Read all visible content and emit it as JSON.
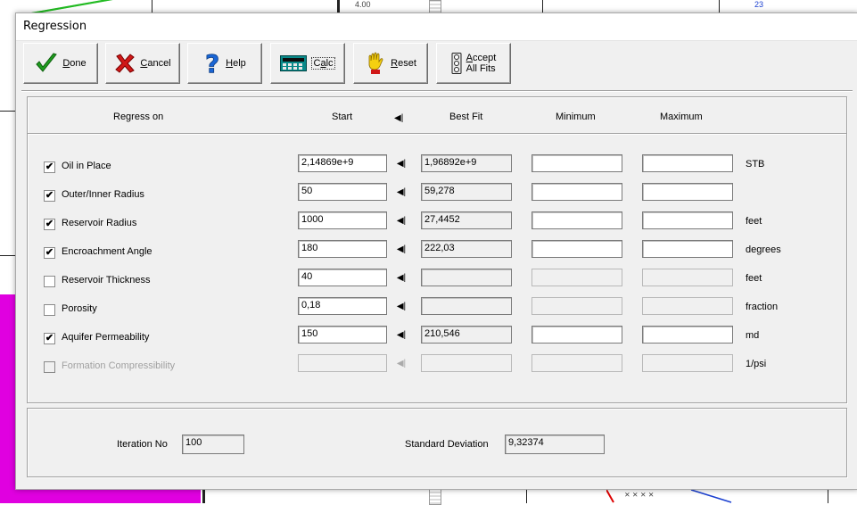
{
  "background": {
    "tick_label": "4.00",
    "tick_label_2": "23"
  },
  "dialog": {
    "title": "Regression"
  },
  "toolbar": {
    "done": {
      "prefix": "",
      "mnemonic": "D",
      "suffix": "one",
      "icon": "checkmark-icon"
    },
    "cancel": {
      "prefix": "",
      "mnemonic": "C",
      "suffix": "ancel",
      "icon": "red-x-icon"
    },
    "help": {
      "prefix": "",
      "mnemonic": "H",
      "suffix": "elp",
      "icon": "question-mark-icon"
    },
    "calc": {
      "prefix": "C",
      "mnemonic": "a",
      "suffix": "lc",
      "icon": "calculator-icon"
    },
    "reset": {
      "prefix": "",
      "mnemonic": "R",
      "suffix": "eset",
      "icon": "hand-stop-icon"
    },
    "accept": {
      "line1_prefix": "",
      "line1_mnemonic": "A",
      "line1_suffix": "ccept",
      "line2": "All Fits",
      "icon": "traffic-light-icon"
    }
  },
  "table": {
    "headers": {
      "regress_on": "Regress on",
      "start": "Start",
      "best_fit": "Best Fit",
      "minimum": "Minimum",
      "maximum": "Maximum"
    },
    "arrow_glyph": "◀|",
    "rows": [
      {
        "label": "Oil in Place",
        "checked": true,
        "enabled": true,
        "check_glyph": "✔",
        "start": "2,14869e+9",
        "best_fit": "1,96892e+9",
        "minimum": "",
        "maximum": "",
        "unit": "STB"
      },
      {
        "label": "Outer/Inner Radius",
        "checked": true,
        "enabled": true,
        "check_glyph": "✔",
        "start": "50",
        "best_fit": "59,278",
        "minimum": "",
        "maximum": "",
        "unit": ""
      },
      {
        "label": "Reservoir Radius",
        "checked": true,
        "enabled": true,
        "check_glyph": "✔",
        "start": "1000",
        "best_fit": "27,4452",
        "minimum": "",
        "maximum": "",
        "unit": "feet"
      },
      {
        "label": "Encroachment Angle",
        "checked": true,
        "enabled": true,
        "check_glyph": "✔",
        "start": "180",
        "best_fit": "222,03",
        "minimum": "",
        "maximum": "",
        "unit": "degrees"
      },
      {
        "label": "Reservoir Thickness",
        "checked": false,
        "enabled": true,
        "check_glyph": "",
        "start": "40",
        "best_fit": "",
        "minimum": "",
        "maximum": "",
        "unit": "feet"
      },
      {
        "label": "Porosity",
        "checked": false,
        "enabled": true,
        "check_glyph": "",
        "start": "0,18",
        "best_fit": "",
        "minimum": "",
        "maximum": "",
        "unit": "fraction"
      },
      {
        "label": "Aquifer Permeability",
        "checked": true,
        "enabled": true,
        "check_glyph": "✔",
        "start": "150",
        "best_fit": "210,546",
        "minimum": "",
        "maximum": "",
        "unit": "md"
      },
      {
        "label": "Formation Compressibility",
        "checked": false,
        "enabled": false,
        "check_glyph": "",
        "start": "",
        "best_fit": "",
        "minimum": "",
        "maximum": "",
        "unit": "1/psi"
      }
    ]
  },
  "footer": {
    "iteration_label": "Iteration No",
    "iteration_value": "100",
    "std_dev_label": "Standard Deviation",
    "std_dev_value": "9,32374"
  }
}
